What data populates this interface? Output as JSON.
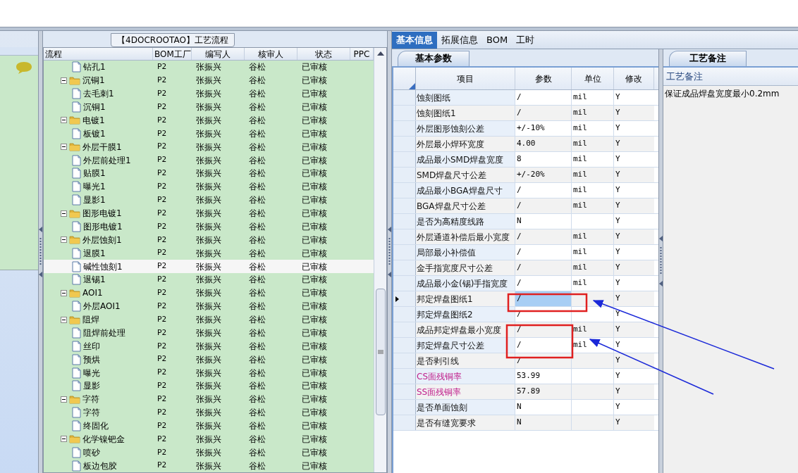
{
  "flow_panel": {
    "title": "【4DOCROOTAO】工艺流程",
    "columns": [
      "流程",
      "BOM工厂",
      "编写人",
      "核审人",
      "状态",
      "PPC"
    ],
    "rows": [
      {
        "kind": "file",
        "name": "钻孔1",
        "bom": "P2",
        "writer": "张振兴",
        "reviewer": "谷松",
        "status": "已审核",
        "selected": false
      },
      {
        "kind": "folder",
        "name": "沉铜1",
        "bom": "P2",
        "writer": "张振兴",
        "reviewer": "谷松",
        "status": "已审核",
        "selected": false,
        "expanded": true,
        "children": [
          {
            "kind": "file",
            "name": "去毛刺1",
            "bom": "P2",
            "writer": "张振兴",
            "reviewer": "谷松",
            "status": "已审核",
            "selected": false
          },
          {
            "kind": "file",
            "name": "沉铜1",
            "bom": "P2",
            "writer": "张振兴",
            "reviewer": "谷松",
            "status": "已审核",
            "selected": false
          }
        ]
      },
      {
        "kind": "folder",
        "name": "电镀1",
        "bom": "P2",
        "writer": "张振兴",
        "reviewer": "谷松",
        "status": "已审核",
        "selected": false,
        "expanded": true,
        "children": [
          {
            "kind": "file",
            "name": "板镀1",
            "bom": "P2",
            "writer": "张振兴",
            "reviewer": "谷松",
            "status": "已审核",
            "selected": false
          }
        ]
      },
      {
        "kind": "folder",
        "name": "外层干膜1",
        "bom": "P2",
        "writer": "张振兴",
        "reviewer": "谷松",
        "status": "已审核",
        "selected": false,
        "expanded": true,
        "children": [
          {
            "kind": "file",
            "name": "外层前处理1",
            "bom": "P2",
            "writer": "张振兴",
            "reviewer": "谷松",
            "status": "已审核",
            "selected": false
          },
          {
            "kind": "file",
            "name": "贴膜1",
            "bom": "P2",
            "writer": "张振兴",
            "reviewer": "谷松",
            "status": "已审核",
            "selected": false
          },
          {
            "kind": "file",
            "name": "曝光1",
            "bom": "P2",
            "writer": "张振兴",
            "reviewer": "谷松",
            "status": "已审核",
            "selected": false
          },
          {
            "kind": "file",
            "name": "显影1",
            "bom": "P2",
            "writer": "张振兴",
            "reviewer": "谷松",
            "status": "已审核",
            "selected": false
          }
        ]
      },
      {
        "kind": "folder",
        "name": "图形电镀1",
        "bom": "P2",
        "writer": "张振兴",
        "reviewer": "谷松",
        "status": "已审核",
        "selected": false,
        "expanded": true,
        "children": [
          {
            "kind": "file",
            "name": "图形电镀1",
            "bom": "P2",
            "writer": "张振兴",
            "reviewer": "谷松",
            "status": "已审核",
            "selected": false
          }
        ]
      },
      {
        "kind": "folder",
        "name": "外层蚀刻1",
        "bom": "P2",
        "writer": "张振兴",
        "reviewer": "谷松",
        "status": "已审核",
        "selected": false,
        "expanded": true,
        "children": [
          {
            "kind": "file",
            "name": "退膜1",
            "bom": "P2",
            "writer": "张振兴",
            "reviewer": "谷松",
            "status": "已审核",
            "selected": false
          },
          {
            "kind": "file",
            "name": "碱性蚀刻1",
            "bom": "P2",
            "writer": "张振兴",
            "reviewer": "谷松",
            "status": "已审核",
            "selected": true
          },
          {
            "kind": "file",
            "name": "退锡1",
            "bom": "P2",
            "writer": "张振兴",
            "reviewer": "谷松",
            "status": "已审核",
            "selected": false
          }
        ]
      },
      {
        "kind": "folder",
        "name": "AOI1",
        "bom": "P2",
        "writer": "张振兴",
        "reviewer": "谷松",
        "status": "已审核",
        "selected": false,
        "expanded": true,
        "children": [
          {
            "kind": "file",
            "name": "外层AOI1",
            "bom": "P2",
            "writer": "张振兴",
            "reviewer": "谷松",
            "status": "已审核",
            "selected": false
          }
        ]
      },
      {
        "kind": "folder",
        "name": "阻焊",
        "bom": "P2",
        "writer": "张振兴",
        "reviewer": "谷松",
        "status": "已审核",
        "selected": false,
        "expanded": true,
        "children": [
          {
            "kind": "file",
            "name": "阻焊前处理",
            "bom": "P2",
            "writer": "张振兴",
            "reviewer": "谷松",
            "status": "已审核",
            "selected": false
          },
          {
            "kind": "file",
            "name": "丝印",
            "bom": "P2",
            "writer": "张振兴",
            "reviewer": "谷松",
            "status": "已审核",
            "selected": false
          },
          {
            "kind": "file",
            "name": "预烘",
            "bom": "P2",
            "writer": "张振兴",
            "reviewer": "谷松",
            "status": "已审核",
            "selected": false
          },
          {
            "kind": "file",
            "name": "曝光",
            "bom": "P2",
            "writer": "张振兴",
            "reviewer": "谷松",
            "status": "已审核",
            "selected": false
          },
          {
            "kind": "file",
            "name": "显影",
            "bom": "P2",
            "writer": "张振兴",
            "reviewer": "谷松",
            "status": "已审核",
            "selected": false
          }
        ]
      },
      {
        "kind": "folder",
        "name": "字符",
        "bom": "P2",
        "writer": "张振兴",
        "reviewer": "谷松",
        "status": "已审核",
        "selected": false,
        "expanded": true,
        "children": [
          {
            "kind": "file",
            "name": "字符",
            "bom": "P2",
            "writer": "张振兴",
            "reviewer": "谷松",
            "status": "已审核",
            "selected": false
          },
          {
            "kind": "file",
            "name": "终固化",
            "bom": "P2",
            "writer": "张振兴",
            "reviewer": "谷松",
            "status": "已审核",
            "selected": false
          }
        ]
      },
      {
        "kind": "folder",
        "name": "化学镍钯金",
        "bom": "P2",
        "writer": "张振兴",
        "reviewer": "谷松",
        "status": "已审核",
        "selected": false,
        "expanded": true,
        "children": [
          {
            "kind": "file",
            "name": "喷砂",
            "bom": "P2",
            "writer": "张振兴",
            "reviewer": "谷松",
            "status": "已审核",
            "selected": false
          },
          {
            "kind": "file",
            "name": "板边包胶",
            "bom": "P2",
            "writer": "张振兴",
            "reviewer": "谷松",
            "status": "已审核",
            "selected": false
          }
        ]
      }
    ]
  },
  "tabs": [
    {
      "label": "基本信息",
      "selected": true
    },
    {
      "label": "拓展信息",
      "selected": false
    },
    {
      "label": "BOM",
      "selected": false
    },
    {
      "label": "工时",
      "selected": false
    }
  ],
  "params_panel": {
    "tab": "基本参数",
    "columns": [
      "项目",
      "参数",
      "单位",
      "修改"
    ],
    "rows": [
      {
        "item": "蚀刻图纸",
        "value": "/",
        "unit": "mil",
        "modify": "Y",
        "current": false,
        "selected": false
      },
      {
        "item": "蚀刻图纸1",
        "value": "/",
        "unit": "mil",
        "modify": "Y",
        "current": false,
        "selected": false
      },
      {
        "item": "外层图形蚀刻公差",
        "value": "+/-10%",
        "unit": "mil",
        "modify": "Y",
        "current": false,
        "selected": false
      },
      {
        "item": "外层最小焊环宽度",
        "value": "4.00",
        "unit": "mil",
        "modify": "Y",
        "current": false,
        "selected": false
      },
      {
        "item": "成品最小SMD焊盘宽度",
        "value": "8",
        "unit": "mil",
        "modify": "Y",
        "current": false,
        "selected": false
      },
      {
        "item": "SMD焊盘尺寸公差",
        "value": "+/-20%",
        "unit": "mil",
        "modify": "Y",
        "current": false,
        "selected": false
      },
      {
        "item": "成品最小BGA焊盘尺寸",
        "value": "/",
        "unit": "mil",
        "modify": "Y",
        "current": false,
        "selected": false
      },
      {
        "item": "BGA焊盘尺寸公差",
        "value": "/",
        "unit": "mil",
        "modify": "Y",
        "current": false,
        "selected": false
      },
      {
        "item": "是否为高精度线路",
        "value": "N",
        "modify": "Y",
        "current": false,
        "selected": false
      },
      {
        "item": "外层通道补偿后最小宽度",
        "value": "/",
        "unit": "mil",
        "modify": "Y",
        "current": false,
        "selected": false
      },
      {
        "item": "局部最小补偿值",
        "value": "/",
        "unit": "mil",
        "modify": "Y",
        "current": false,
        "selected": false
      },
      {
        "item": "金手指宽度尺寸公差",
        "value": "/",
        "unit": "mil",
        "modify": "Y",
        "current": false,
        "selected": false
      },
      {
        "item": "成品最小金(锡)手指宽度",
        "value": "/",
        "unit": "mil",
        "modify": "Y",
        "current": false,
        "selected": false
      },
      {
        "item": "邦定焊盘图纸1",
        "value": "/",
        "modify": "Y",
        "current": true,
        "selected": true
      },
      {
        "item": "邦定焊盘图纸2",
        "value": "/",
        "modify": "Y",
        "current": false,
        "selected": false
      },
      {
        "item": "成品邦定焊盘最小宽度",
        "value": "/",
        "unit": "mil",
        "modify": "Y",
        "current": false,
        "selected": false
      },
      {
        "item": "邦定焊盘尺寸公差",
        "value": "/",
        "unit": "mil",
        "modify": "Y",
        "current": false,
        "selected": false
      },
      {
        "item": "是否剥引线",
        "value": "/",
        "modify": "Y",
        "current": false,
        "selected": false
      },
      {
        "item": "CS面残铜率",
        "value": "53.99",
        "modify": "Y",
        "color": "#c0208c",
        "current": false,
        "selected": false
      },
      {
        "item": "SS面残铜率",
        "value": "57.89",
        "modify": "Y",
        "color": "#c0208c",
        "current": false,
        "selected": false
      },
      {
        "item": "是否单面蚀刻",
        "value": "N",
        "modify": "Y",
        "current": false,
        "selected": false
      },
      {
        "item": "是否有缝宽要求",
        "value": "N",
        "modify": "Y",
        "current": false,
        "selected": false
      }
    ]
  },
  "notes_panel": {
    "tab": "工艺备注",
    "label": "工艺备注",
    "text": "保证成品焊盘宽度最小0.2mm"
  }
}
